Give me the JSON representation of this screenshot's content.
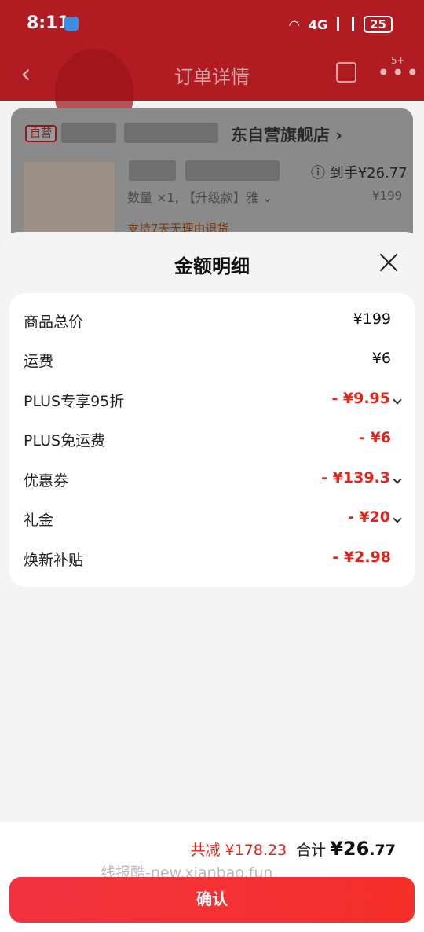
{
  "status_bar": {
    "time": "8:11",
    "network": "4G",
    "battery": "25"
  },
  "header": {
    "title": "订单详情",
    "badge": "5+"
  },
  "store": {
    "tag": "自营",
    "name": "东自营旗舰店 ›"
  },
  "product": {
    "final_price_label": "ⓘ 到手¥26.77",
    "quantity_line": "数量 ×1, 【升级款】雅 ⌄",
    "original_price": "¥199",
    "return_policy": "支持7天无理由退货"
  },
  "sheet": {
    "title": "金额明细",
    "rows": [
      {
        "label": "商品总价",
        "amount": "¥199"
      },
      {
        "label": "运费",
        "amount": "¥6"
      },
      {
        "label": "PLUS专享95折",
        "amount": "- ¥9.95"
      },
      {
        "label": "PLUS免运费",
        "amount": "- ¥6"
      },
      {
        "label": "优惠券",
        "amount": "- ¥139.3"
      },
      {
        "label": "礼金",
        "amount": "- ¥20"
      },
      {
        "label": "焕新补贴",
        "amount": "- ¥2.98"
      }
    ]
  },
  "footer": {
    "total_saved": "共减 ¥178.23",
    "total_label": "合计",
    "total_main": "¥26",
    "total_decimal": ".77",
    "watermark": "线报酷-new.xianbao.fun",
    "confirm_label": "确认"
  },
  "colors": {
    "brand_red": "#e1251b",
    "button_red": "#f2333f",
    "header_red": "#b01c22"
  }
}
